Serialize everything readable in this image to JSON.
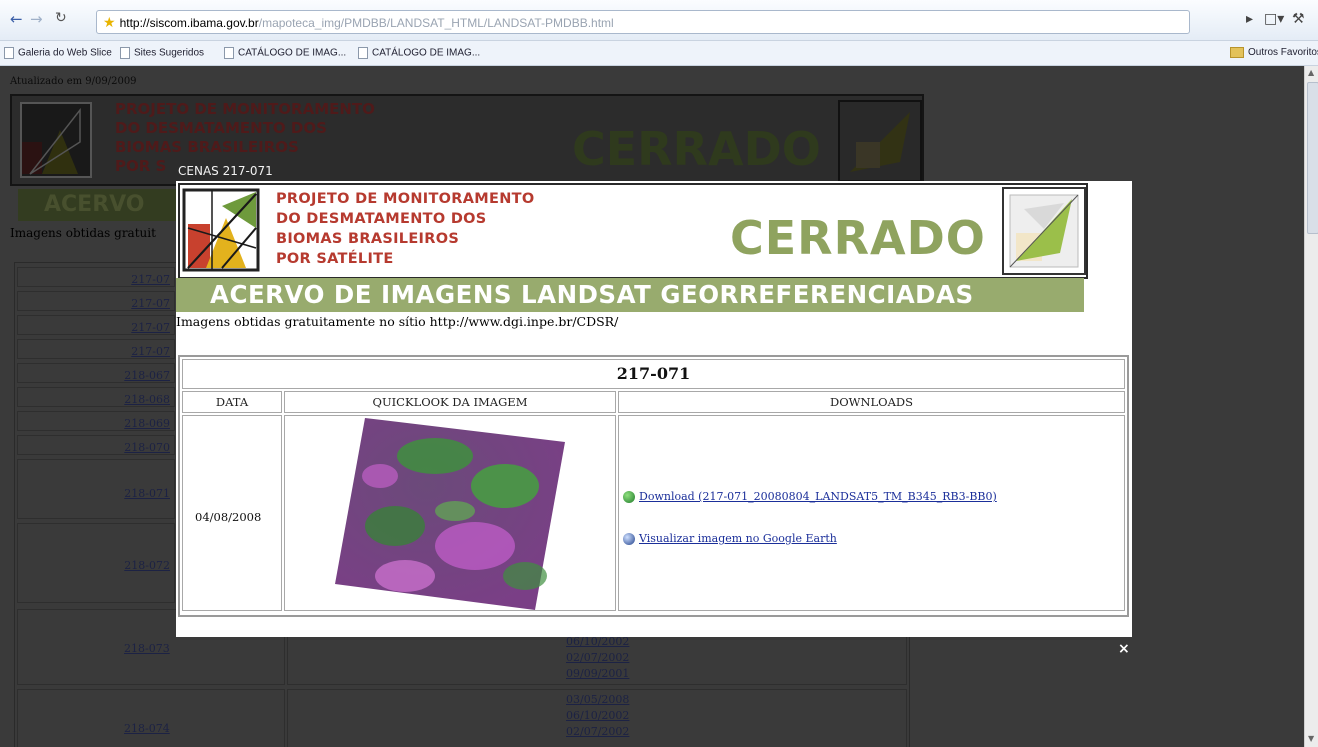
{
  "browser": {
    "url_host": "http://siscom.ibama.gov.br",
    "url_path": "/mapoteca_img/PMDBB/LANDSAT_HTML/LANDSAT-PMDBB.html",
    "bookmarks": [
      "Galeria do Web Slice",
      "Sites Sugeridos",
      "CATÁLOGO DE IMAG...",
      "CATÁLOGO DE IMAG..."
    ],
    "other_favorites": "Outros Favoritos"
  },
  "background_page": {
    "updated": "Atualizado em 9/09/2009",
    "project_lines": [
      "PROJETO DE MONITORAMENTO",
      "DO DESMATAMENTO DOS",
      "BIOMAS BRASILEIROS",
      "POR S"
    ],
    "cerrado": "CERRADO",
    "acervo_short": "ACERVO",
    "imagens_short": "Imagens obtidas gratuit",
    "scene_links": [
      "217-07",
      "217-07",
      "217-07",
      "217-07",
      "218-067",
      "218-068",
      "218-069",
      "218-070",
      "218-071",
      "218-072",
      "218-073",
      "218-074"
    ],
    "date_links_073": [
      "06/10/2002",
      "02/07/2002",
      "09/09/2001"
    ],
    "date_links_074": [
      "03/05/2008",
      "06/10/2002",
      "02/07/2002"
    ]
  },
  "lightbox": {
    "title": "CENAS 217-071",
    "close": "×",
    "project_lines": [
      "PROJETO DE MONITORAMENTO",
      "DO DESMATAMENTO DOS",
      "BIOMAS BRASILEIROS",
      "POR SATÉLITE"
    ],
    "cerrado": "CERRADO",
    "acervo": "ACERVO DE IMAGENS LANDSAT GEORREFERENCIADAS",
    "imagens_text": "Imagens obtidas gratuitamente no sítio http://www.dgi.inpe.br/CDSR/",
    "table": {
      "scene": "217-071",
      "headers": [
        "DATA",
        "QUICKLOOK DA IMAGEM",
        "DOWNLOADS"
      ],
      "date": "04/08/2008",
      "download_label": "Download (217-071_20080804_LANDSAT5_TM_B345_RB3-BB0)",
      "earth_label": "Visualizar imagem no Google Earth"
    }
  }
}
